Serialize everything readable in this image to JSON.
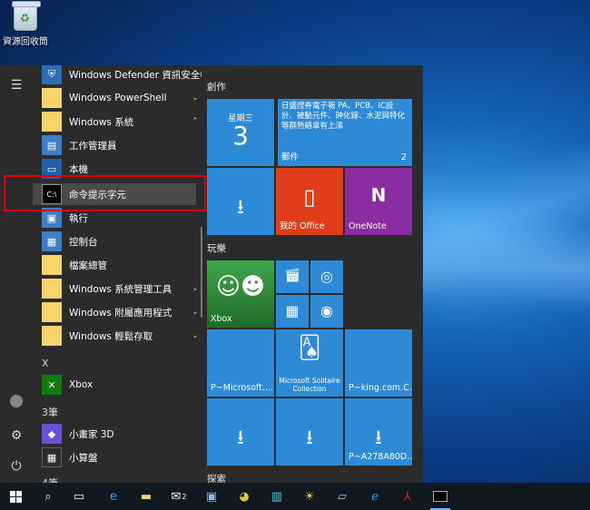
{
  "desktop": {
    "recycle_bin_label": "資源回收筒"
  },
  "start_menu": {
    "apps": [
      {
        "label": "Windows Defender 資訊安全中心",
        "icon": "shield-icon"
      },
      {
        "label": "Windows PowerShell",
        "icon": "folder-icon"
      },
      {
        "label": "Windows 系統",
        "icon": "folder-icon"
      },
      {
        "label": "工作管理員",
        "icon": "task-manager-icon"
      },
      {
        "label": "本機",
        "icon": "computer-icon"
      },
      {
        "label": "命令提示字元",
        "icon": "command-prompt-icon"
      },
      {
        "label": "執行",
        "icon": "run-icon"
      },
      {
        "label": "控制台",
        "icon": "control-panel-icon"
      },
      {
        "label": "檔案總管",
        "icon": "file-explorer-icon"
      },
      {
        "label": "Windows 系統管理工具",
        "icon": "folder-icon"
      },
      {
        "label": "Windows 附屬應用程式",
        "icon": "folder-icon"
      },
      {
        "label": "Windows 輕鬆存取",
        "icon": "folder-icon"
      },
      {
        "label": "Xbox",
        "icon": "xbox-icon"
      },
      {
        "label": "小畫家 3D",
        "icon": "paint3d-icon"
      },
      {
        "label": "小算盤",
        "icon": "calculator-icon"
      }
    ],
    "letters": {
      "x": "X",
      "three": "3筆",
      "four": "4筆"
    },
    "groups": {
      "create": "創作",
      "play": "玩樂",
      "explore": "探索"
    },
    "tiles": {
      "calendar": {
        "day": "星期三",
        "date": "3"
      },
      "news": {
        "text": "日盛證券電子報 PA、PCB、IC設計、被動元件、砷化鎵、水泥與特化等群熱絡拿有上漲",
        "app": "郵件",
        "count": "2"
      },
      "office": {
        "label": "我的 Office"
      },
      "onenote": {
        "label": "OneNote"
      },
      "xbox": {
        "label": "Xbox"
      },
      "microsoft_app": {
        "label": "P~Microsoft...."
      },
      "solitaire": {
        "label": "Microsoft Solitaire Collection"
      },
      "king": {
        "label": "P~king.com.C..."
      },
      "a278": {
        "label": "P~A278A80D...."
      }
    }
  },
  "taskbar": {
    "items": [
      "start-icon",
      "search-icon",
      "task-view-icon",
      "edge-icon",
      "file-explorer-icon",
      "mail-icon",
      "network-icon",
      "chrome-icon",
      "building-icon",
      "sun-icon",
      "notepad-icon",
      "ie-icon",
      "acrobat-icon",
      "cmd-icon"
    ],
    "mail_badge": "2"
  },
  "colors": {
    "accent": "#2d8ad6",
    "office": "#e03e1a",
    "onenote": "#8a2da0",
    "highlight": "#e00000"
  }
}
